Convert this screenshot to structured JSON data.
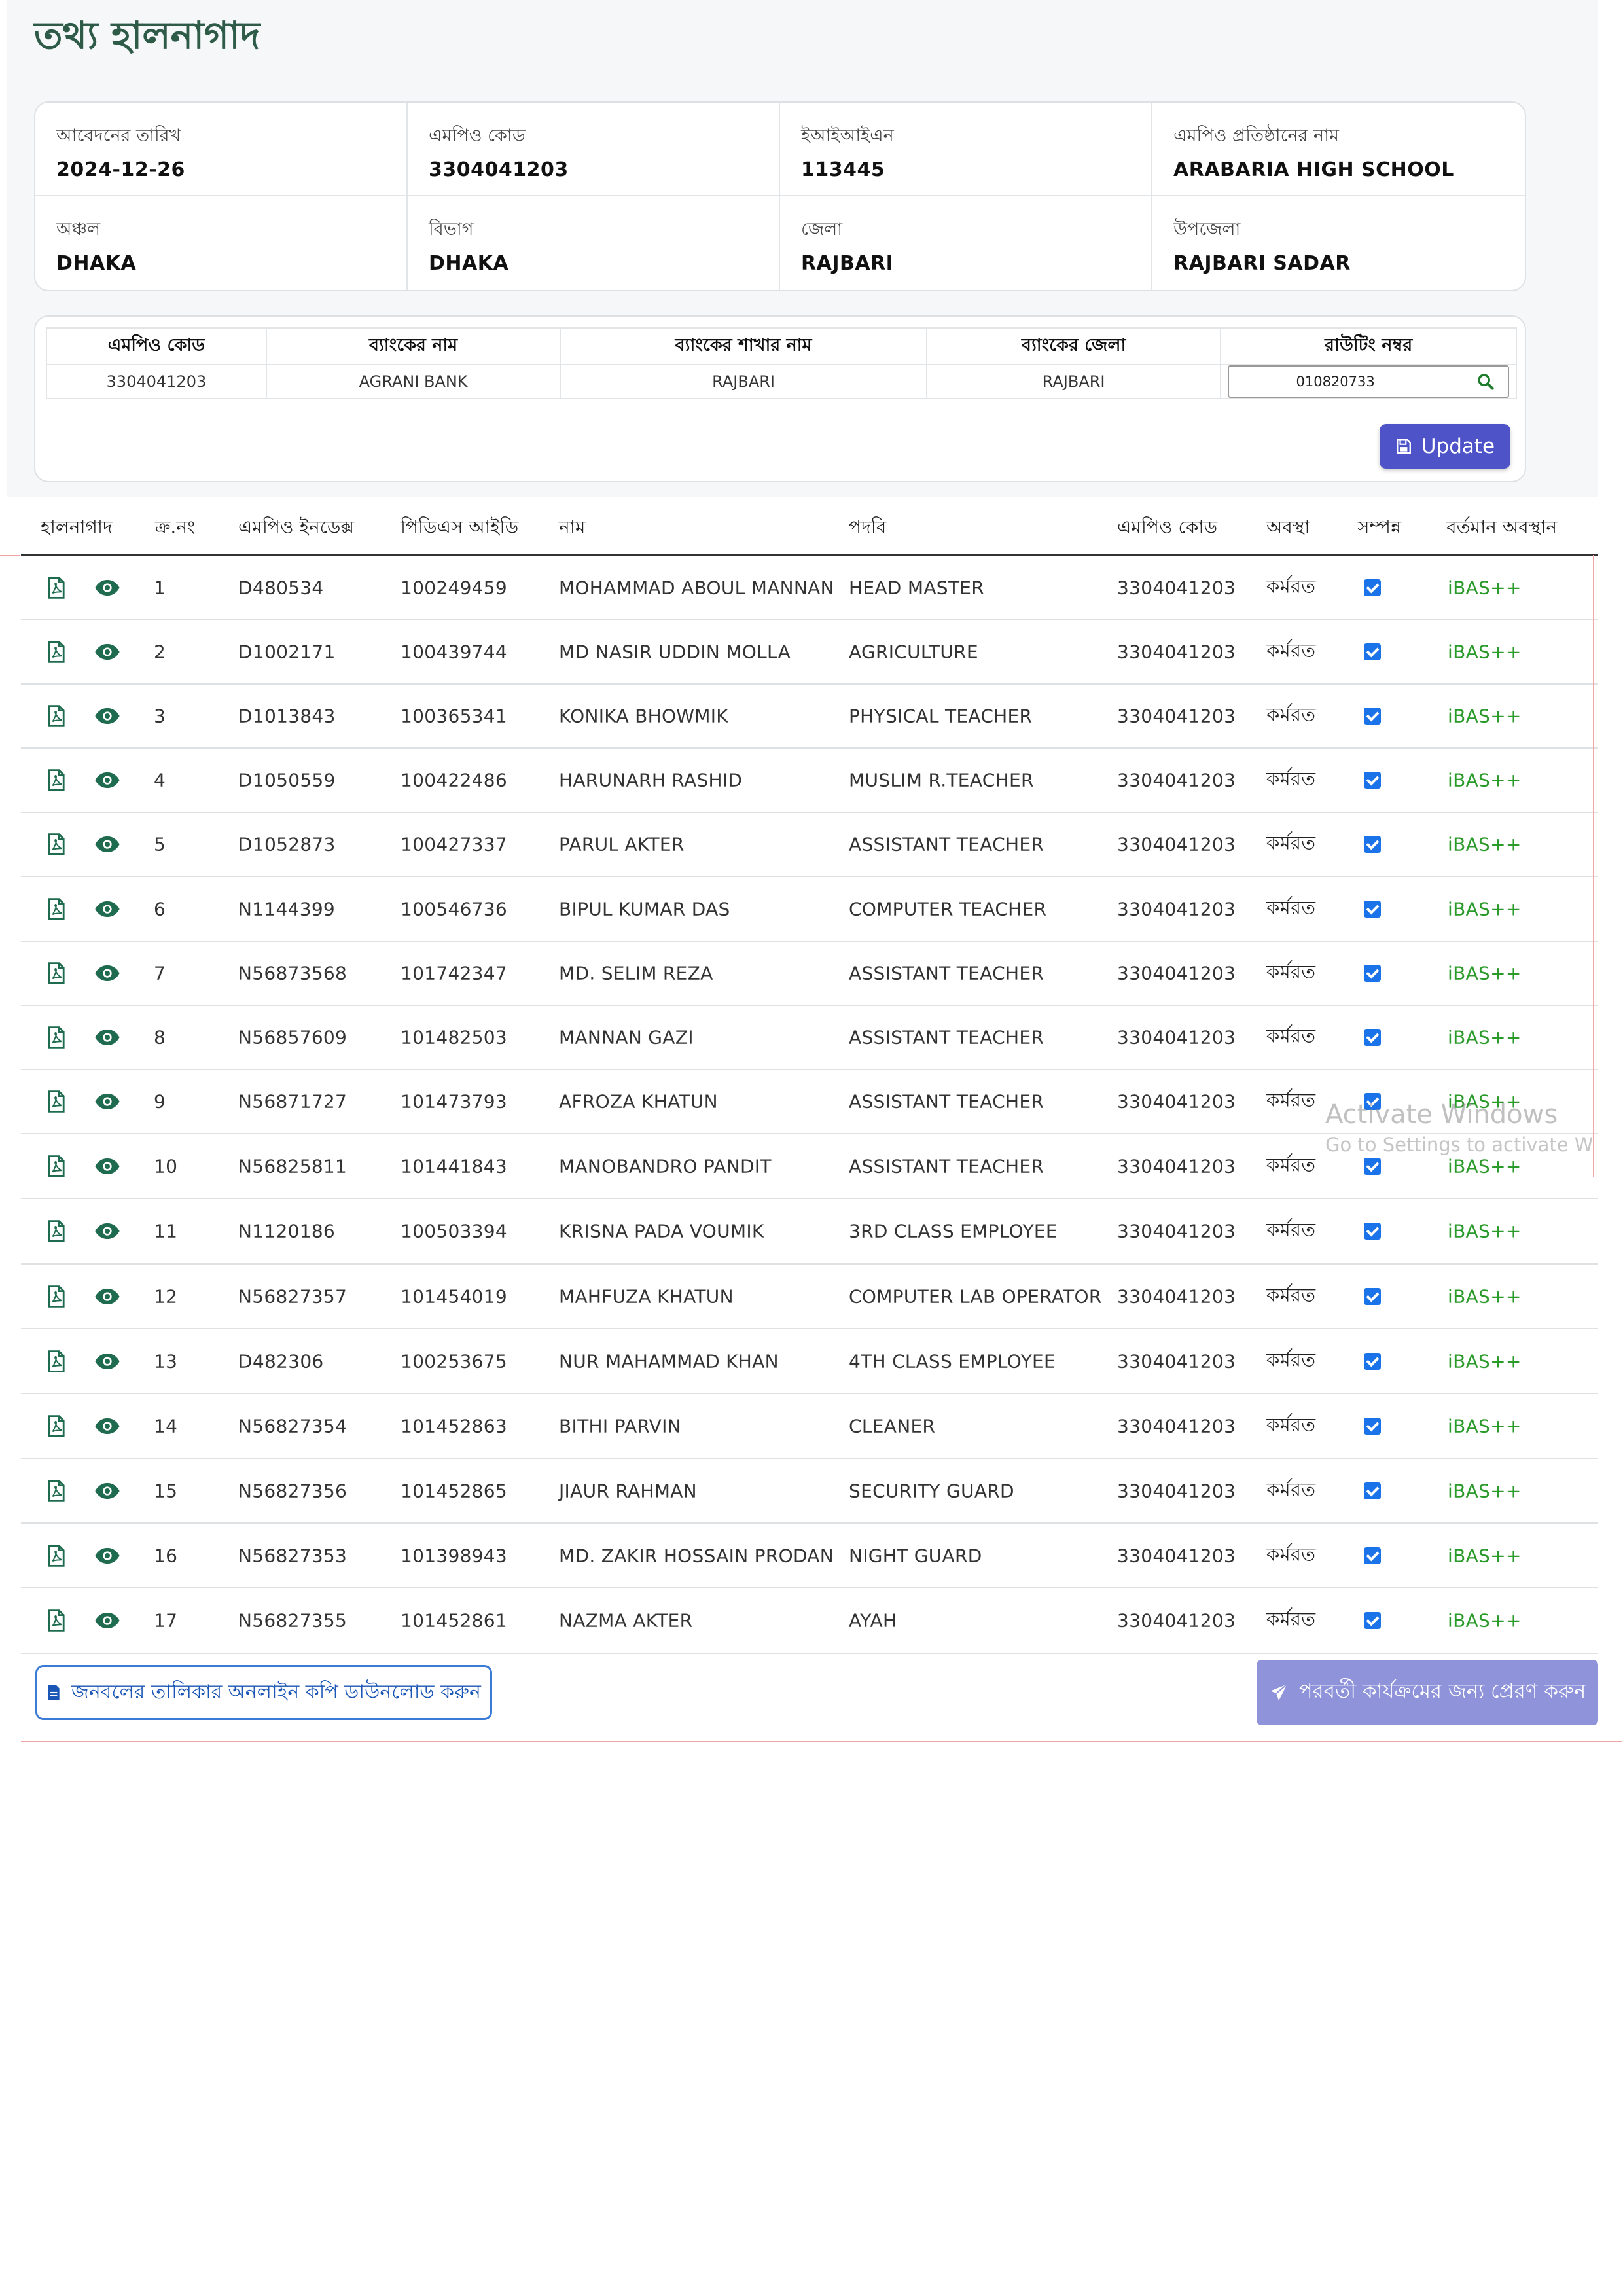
{
  "page": {
    "title": "তথ্য হালনাগাদ"
  },
  "info": [
    {
      "label": "আবেদনের তারিখ",
      "value": "2024-12-26"
    },
    {
      "label": "এমপিও কোড",
      "value": "3304041203"
    },
    {
      "label": "ইআইআইএন",
      "value": "113445"
    },
    {
      "label": "এমপিও প্রতিষ্ঠানের নাম",
      "value": "ARABARIA HIGH SCHOOL"
    },
    {
      "label": "অঞ্চল",
      "value": "DHAKA"
    },
    {
      "label": "বিভাগ",
      "value": "DHAKA"
    },
    {
      "label": "জেলা",
      "value": "RAJBARI"
    },
    {
      "label": "উপজেলা",
      "value": "RAJBARI SADAR"
    }
  ],
  "bank": {
    "headers": [
      "এমপিও কোড",
      "ব্যাংকের নাম",
      "ব্যাংকের শাখার নাম",
      "ব্যাংকের জেলা",
      "রাউটিং নম্বর"
    ],
    "row": {
      "mpo_code": "3304041203",
      "bank_name": "AGRANI BANK",
      "branch": "RAJBARI",
      "district": "RAJBARI",
      "routing": "010820733"
    },
    "update_label": "Update"
  },
  "staff": {
    "headers": [
      "হালনাগাদ",
      "ক্র.নং",
      "এমপিও ইনডেক্স",
      "পিডিএস আইডি",
      "নাম",
      "পদবি",
      "এমপিও কোড",
      "অবস্থা",
      "সম্পন্ন",
      "বর্তমান অবস্থান"
    ],
    "rows": [
      {
        "sl": "1",
        "index": "D480534",
        "pds": "100249459",
        "name": "MOHAMMAD ABOUL MANNAN",
        "designation": "HEAD MASTER",
        "mpo": "3304041203",
        "status": "কর্মরত",
        "done": true,
        "location": "iBAS++"
      },
      {
        "sl": "2",
        "index": "D1002171",
        "pds": "100439744",
        "name": "MD NASIR UDDIN MOLLA",
        "designation": "AGRICULTURE",
        "mpo": "3304041203",
        "status": "কর্মরত",
        "done": true,
        "location": "iBAS++"
      },
      {
        "sl": "3",
        "index": "D1013843",
        "pds": "100365341",
        "name": "KONIKA BHOWMIK",
        "designation": "PHYSICAL TEACHER",
        "mpo": "3304041203",
        "status": "কর্মরত",
        "done": true,
        "location": "iBAS++"
      },
      {
        "sl": "4",
        "index": "D1050559",
        "pds": "100422486",
        "name": "HARUNARH RASHID",
        "designation": "MUSLIM R.TEACHER",
        "mpo": "3304041203",
        "status": "কর্মরত",
        "done": true,
        "location": "iBAS++"
      },
      {
        "sl": "5",
        "index": "D1052873",
        "pds": "100427337",
        "name": "PARUL AKTER",
        "designation": "ASSISTANT TEACHER",
        "mpo": "3304041203",
        "status": "কর্মরত",
        "done": true,
        "location": "iBAS++"
      },
      {
        "sl": "6",
        "index": "N1144399",
        "pds": "100546736",
        "name": "BIPUL KUMAR DAS",
        "designation": "COMPUTER TEACHER",
        "mpo": "3304041203",
        "status": "কর্মরত",
        "done": true,
        "location": "iBAS++"
      },
      {
        "sl": "7",
        "index": "N56873568",
        "pds": "101742347",
        "name": "MD. SELIM REZA",
        "designation": "ASSISTANT TEACHER",
        "mpo": "3304041203",
        "status": "কর্মরত",
        "done": true,
        "location": "iBAS++"
      },
      {
        "sl": "8",
        "index": "N56857609",
        "pds": "101482503",
        "name": "MANNAN GAZI",
        "designation": "ASSISTANT TEACHER",
        "mpo": "3304041203",
        "status": "কর্মরত",
        "done": true,
        "location": "iBAS++"
      },
      {
        "sl": "9",
        "index": "N56871727",
        "pds": "101473793",
        "name": "AFROZA KHATUN",
        "designation": "ASSISTANT TEACHER",
        "mpo": "3304041203",
        "status": "কর্মরত",
        "done": true,
        "location": "iBAS++"
      },
      {
        "sl": "10",
        "index": "N56825811",
        "pds": "101441843",
        "name": "MANOBANDRO PANDIT",
        "designation": "ASSISTANT TEACHER",
        "mpo": "3304041203",
        "status": "কর্মরত",
        "done": true,
        "location": "iBAS++"
      },
      {
        "sl": "11",
        "index": "N1120186",
        "pds": "100503394",
        "name": "KRISNA PADA VOUMIK",
        "designation": "3RD CLASS EMPLOYEE",
        "mpo": "3304041203",
        "status": "কর্মরত",
        "done": true,
        "location": "iBAS++"
      },
      {
        "sl": "12",
        "index": "N56827357",
        "pds": "101454019",
        "name": "MAHFUZA KHATUN",
        "designation": "COMPUTER LAB OPERATOR",
        "mpo": "3304041203",
        "status": "কর্মরত",
        "done": true,
        "location": "iBAS++"
      },
      {
        "sl": "13",
        "index": "D482306",
        "pds": "100253675",
        "name": "NUR MAHAMMAD KHAN",
        "designation": "4TH CLASS EMPLOYEE",
        "mpo": "3304041203",
        "status": "কর্মরত",
        "done": true,
        "location": "iBAS++"
      },
      {
        "sl": "14",
        "index": "N56827354",
        "pds": "101452863",
        "name": "BITHI PARVIN",
        "designation": "CLEANER",
        "mpo": "3304041203",
        "status": "কর্মরত",
        "done": true,
        "location": "iBAS++"
      },
      {
        "sl": "15",
        "index": "N56827356",
        "pds": "101452865",
        "name": "JIAUR RAHMAN",
        "designation": "SECURITY GUARD",
        "mpo": "3304041203",
        "status": "কর্মরত",
        "done": true,
        "location": "iBAS++"
      },
      {
        "sl": "16",
        "index": "N56827353",
        "pds": "101398943",
        "name": "MD. ZAKIR HOSSAIN PRODAN",
        "designation": "NIGHT GUARD",
        "mpo": "3304041203",
        "status": "কর্মরত",
        "done": true,
        "location": "iBAS++"
      },
      {
        "sl": "17",
        "index": "N56827355",
        "pds": "101452861",
        "name": "NAZMA AKTER",
        "designation": "AYAH",
        "mpo": "3304041203",
        "status": "কর্মরত",
        "done": true,
        "location": "iBAS++"
      }
    ]
  },
  "watermark": {
    "line1": "Activate Windows",
    "line2": "Go to Settings to activate Wind"
  },
  "actions": {
    "download_label": "জনবলের তালিকার অনলাইন কপি ডাউনলোড করুন",
    "send_label": "পরবর্তী কার্যক্রমের জন্য প্রেরণ করুন"
  },
  "colors": {
    "title": "#2e5a48",
    "icon": "#1f6b4f",
    "primary": "#4e54c8",
    "location": "#2a9a2a",
    "check": "#1a73e8"
  }
}
